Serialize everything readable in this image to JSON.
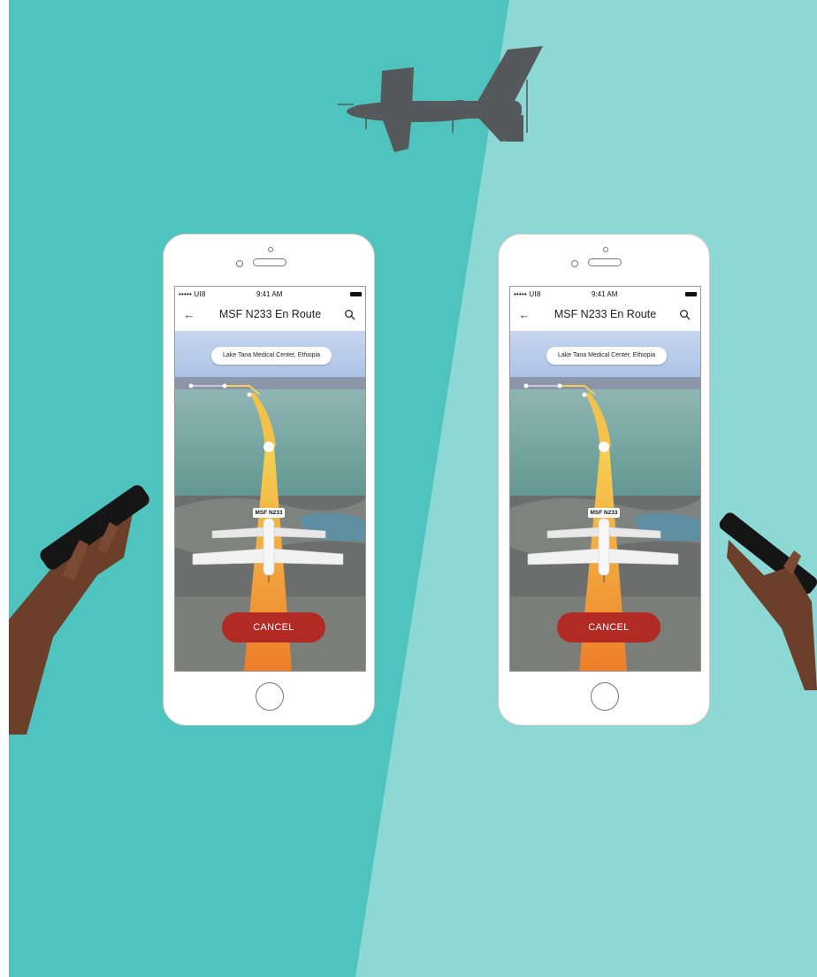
{
  "colors": {
    "background_left": "#4fc3be",
    "background_right": "#8dd8d4",
    "cancel_button": "#b12a24",
    "flight_path": "#f0a93a",
    "skin": "#6b3f2a"
  },
  "icons": [
    "drone-icon",
    "back-arrow-icon",
    "search-icon",
    "plane-icon",
    "home-button-icon",
    "hand-holding-phone-icon"
  ],
  "phones": [
    {
      "status": {
        "carrier": "••••• UI8",
        "time": "9:41 AM"
      },
      "title": "MSF N233 En Route",
      "destination": "Lake Tana Medical Center, Ethiopia",
      "flight_tag": "MSF N233",
      "cancel_label": "CANCEL"
    },
    {
      "status": {
        "carrier": "••••• UI8",
        "time": "9:41 AM"
      },
      "title": "MSF N233 En Route",
      "destination": "Lake Tana Medical Center, Ethiopia",
      "flight_tag": "MSF N233",
      "cancel_label": "CANCEL"
    }
  ]
}
